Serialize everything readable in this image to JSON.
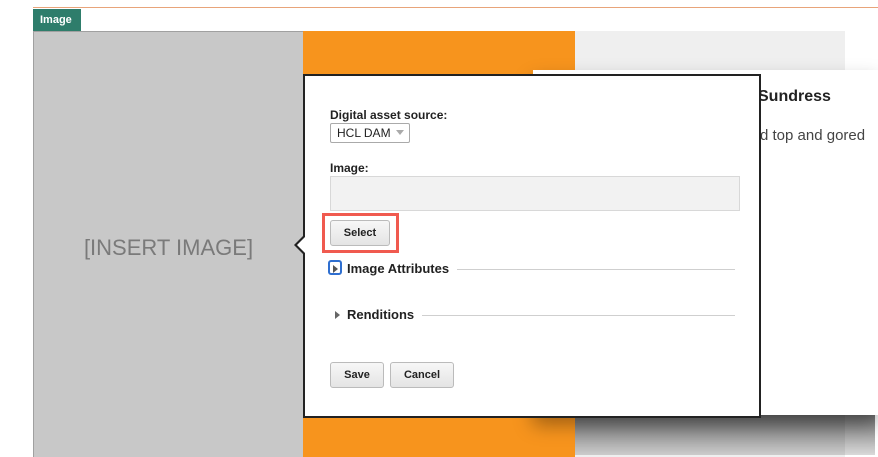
{
  "tag": {
    "label": "Image"
  },
  "placeholder": {
    "text": "[INSERT IMAGE]"
  },
  "product_card": {
    "title": "Sundress",
    "description": "d top and gored"
  },
  "dialog": {
    "asset_source_label": "Digital asset source:",
    "asset_source_value": "HCL DAM",
    "image_label": "Image:",
    "image_value": "",
    "select_button": "Select",
    "sections": [
      {
        "label": "Image Attributes",
        "expanded": false
      },
      {
        "label": "Renditions",
        "expanded": false
      }
    ],
    "save_button": "Save",
    "cancel_button": "Cancel"
  },
  "colors": {
    "tag_bg": "#2e7d6b",
    "placeholder_bg": "#c8c8c8",
    "orange_panel": "#f7941d",
    "highlight": "#f05a4f",
    "focus": "#2f6fd0"
  }
}
